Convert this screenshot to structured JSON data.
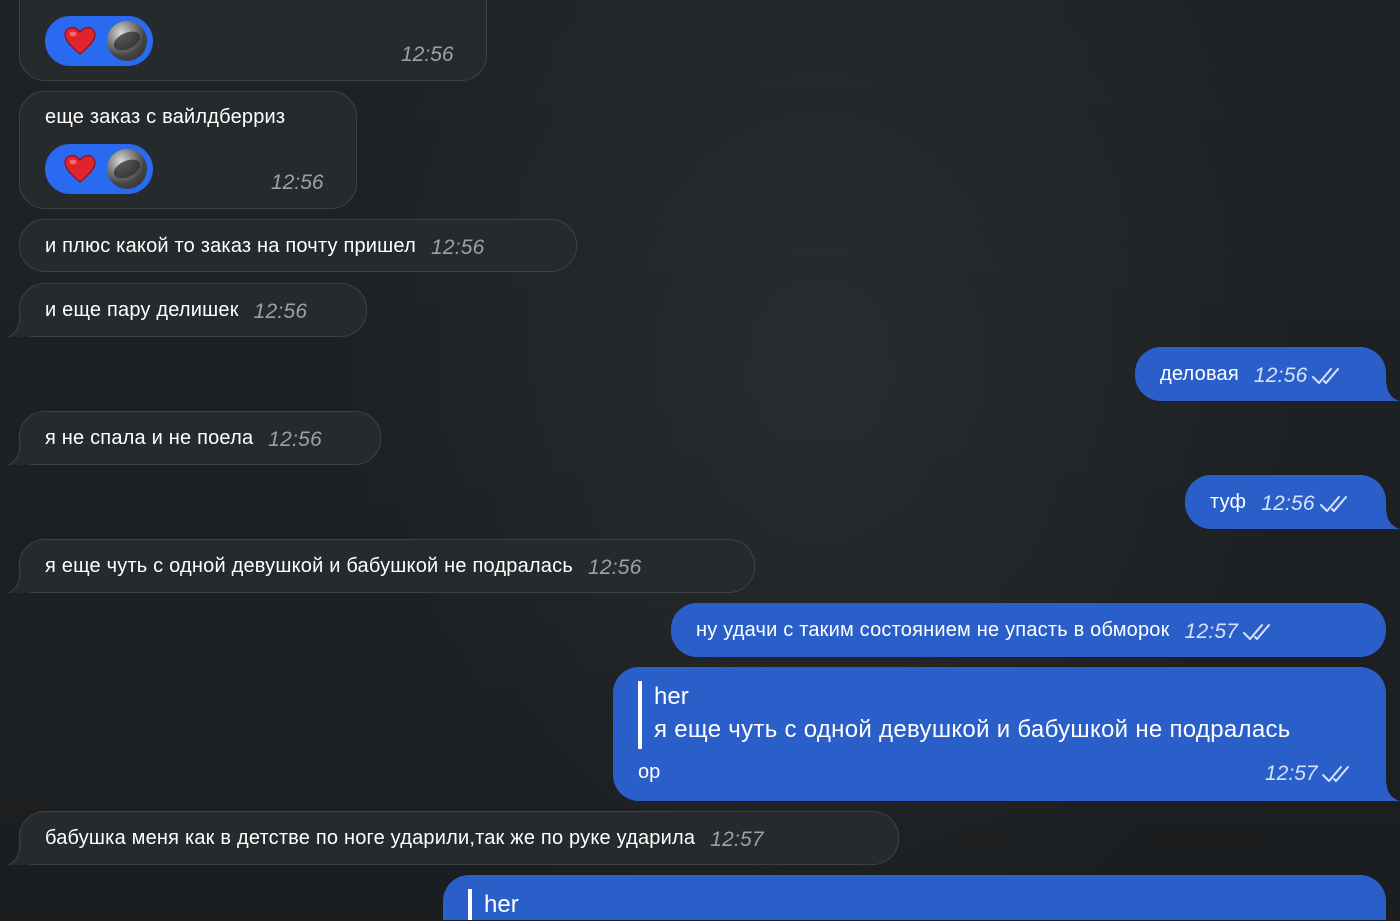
{
  "messages": [
    {
      "side": "in",
      "text": "",
      "time": "12:56",
      "reaction": "❤️"
    },
    {
      "side": "in",
      "text": "еще заказ с вайлдберриз",
      "time": "12:56",
      "reaction": "❤️"
    },
    {
      "side": "in",
      "text": "и плюс какой то заказ на почту пришел",
      "time": "12:56"
    },
    {
      "side": "in",
      "text": "и еще пару делишек",
      "time": "12:56"
    },
    {
      "side": "out",
      "text": "деловая",
      "time": "12:56",
      "read": true
    },
    {
      "side": "in",
      "text": "я не спала и не поела",
      "time": "12:56"
    },
    {
      "side": "out",
      "text": "туф",
      "time": "12:56",
      "read": true
    },
    {
      "side": "in",
      "text": "я еще чуть с одной девушкой и бабушкой не подралась",
      "time": "12:56"
    },
    {
      "side": "out",
      "text": "ну удачи с таким состоянием не упасть в обморок",
      "time": "12:57",
      "read": true
    },
    {
      "side": "out",
      "reply_to": {
        "author": "her",
        "text": "я еще чуть с одной девушкой и бабушкой не подралась"
      },
      "text": "ор",
      "time": "12:57",
      "read": true
    },
    {
      "side": "in",
      "text": "бабушка меня как в детстве по ноге ударили,так же по руке ударила",
      "time": "12:57"
    },
    {
      "side": "out",
      "reply_to": {
        "author": "her"
      }
    }
  ],
  "colors": {
    "background": "#1c1f21",
    "incoming_bubble": "#262a2c",
    "outgoing_bubble": "#2a5fc9",
    "reaction_pill": "#2a6af0",
    "timestamp": "#9aa0a6"
  },
  "icons": {
    "read_receipt": "double-check-icon",
    "reaction": "heart-icon",
    "reactor": "avatar"
  }
}
